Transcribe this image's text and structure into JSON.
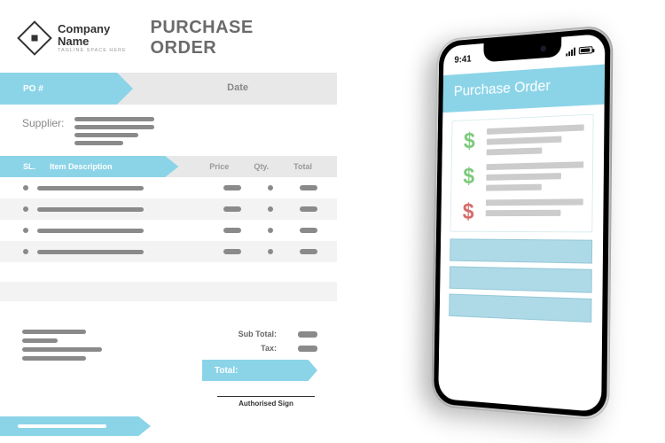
{
  "document": {
    "company_name": "Company Name",
    "tagline": "TAGLINE SPACE HERE",
    "title": "PURCHASE ORDER",
    "po_number_label": "PO #",
    "date_label": "Date",
    "supplier_label": "Supplier:",
    "columns": {
      "sl": "SL.",
      "item": "Item Description",
      "price": "Price",
      "qty": "Qty.",
      "total": "Total"
    },
    "subtotals": {
      "sub_total": "Sub Total:",
      "tax": "Tax:",
      "total": "Total:"
    },
    "authorised_sign": "Authorised Sign"
  },
  "phone": {
    "time": "9:41",
    "app_title": "Purchase Order",
    "entries": [
      {
        "color": "green",
        "symbol": "$"
      },
      {
        "color": "green",
        "symbol": "$"
      },
      {
        "color": "red",
        "symbol": "$"
      }
    ]
  }
}
